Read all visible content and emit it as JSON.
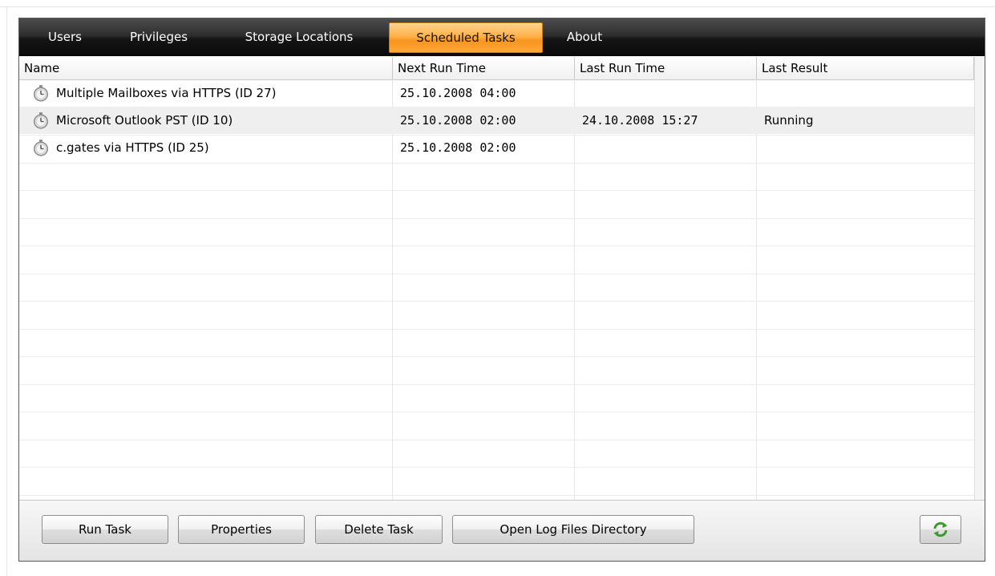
{
  "tabs": [
    {
      "label": "Users"
    },
    {
      "label": "Privileges"
    },
    {
      "label": "Storage Locations"
    },
    {
      "label": "Scheduled Tasks"
    },
    {
      "label": "About"
    }
  ],
  "active_tab": "Scheduled Tasks",
  "columns": [
    "Name",
    "Next Run Time",
    "Last Run Time",
    "Last Result"
  ],
  "rows": [
    {
      "name": "Multiple Mailboxes via HTTPS (ID 27)",
      "next_run": "25.10.2008 04:00",
      "last_run": "",
      "last_result": "",
      "icon": "stopwatch-icon"
    },
    {
      "name": "Microsoft Outlook PST (ID 10)",
      "next_run": "25.10.2008 02:00",
      "last_run": "24.10.2008 15:27",
      "last_result": "Running",
      "icon": "stopwatch-icon"
    },
    {
      "name": "c.gates via HTTPS (ID 25)",
      "next_run": "25.10.2008 02:00",
      "last_run": "",
      "last_result": "",
      "icon": "stopwatch-icon"
    }
  ],
  "buttons": {
    "run_task": "Run Task",
    "properties": "Properties",
    "delete_task": "Delete Task",
    "open_log": "Open Log Files Directory",
    "refresh_icon": "refresh-icon"
  },
  "colors": {
    "active_tab": "#ffa73a",
    "tab_bar": "#1a1a1a",
    "refresh_green": "#3a9a2a"
  }
}
